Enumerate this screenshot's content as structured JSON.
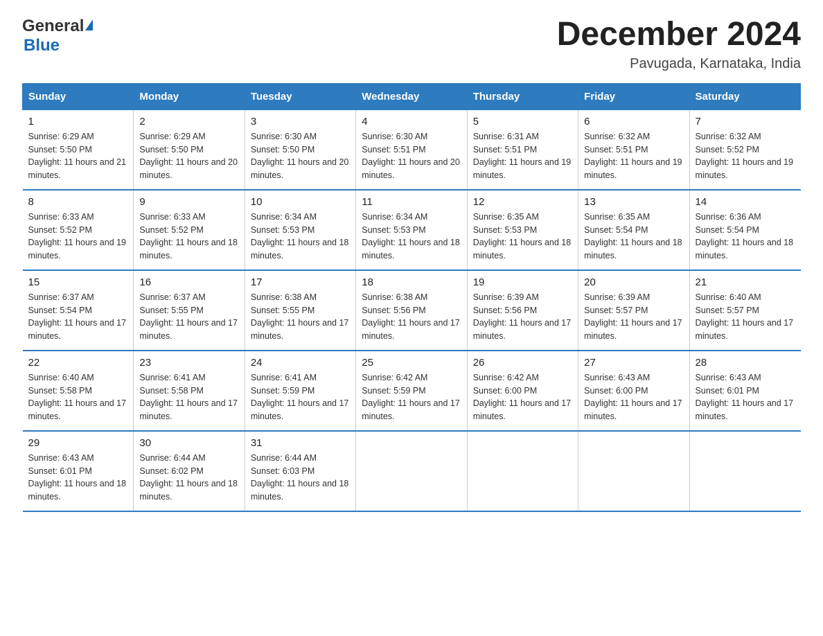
{
  "header": {
    "logo_general": "General",
    "logo_blue": "Blue",
    "month_title": "December 2024",
    "location": "Pavugada, Karnataka, India"
  },
  "days_of_week": [
    "Sunday",
    "Monday",
    "Tuesday",
    "Wednesday",
    "Thursday",
    "Friday",
    "Saturday"
  ],
  "weeks": [
    [
      {
        "day": "1",
        "sunrise": "6:29 AM",
        "sunset": "5:50 PM",
        "daylight": "11 hours and 21 minutes."
      },
      {
        "day": "2",
        "sunrise": "6:29 AM",
        "sunset": "5:50 PM",
        "daylight": "11 hours and 20 minutes."
      },
      {
        "day": "3",
        "sunrise": "6:30 AM",
        "sunset": "5:50 PM",
        "daylight": "11 hours and 20 minutes."
      },
      {
        "day": "4",
        "sunrise": "6:30 AM",
        "sunset": "5:51 PM",
        "daylight": "11 hours and 20 minutes."
      },
      {
        "day": "5",
        "sunrise": "6:31 AM",
        "sunset": "5:51 PM",
        "daylight": "11 hours and 19 minutes."
      },
      {
        "day": "6",
        "sunrise": "6:32 AM",
        "sunset": "5:51 PM",
        "daylight": "11 hours and 19 minutes."
      },
      {
        "day": "7",
        "sunrise": "6:32 AM",
        "sunset": "5:52 PM",
        "daylight": "11 hours and 19 minutes."
      }
    ],
    [
      {
        "day": "8",
        "sunrise": "6:33 AM",
        "sunset": "5:52 PM",
        "daylight": "11 hours and 19 minutes."
      },
      {
        "day": "9",
        "sunrise": "6:33 AM",
        "sunset": "5:52 PM",
        "daylight": "11 hours and 18 minutes."
      },
      {
        "day": "10",
        "sunrise": "6:34 AM",
        "sunset": "5:53 PM",
        "daylight": "11 hours and 18 minutes."
      },
      {
        "day": "11",
        "sunrise": "6:34 AM",
        "sunset": "5:53 PM",
        "daylight": "11 hours and 18 minutes."
      },
      {
        "day": "12",
        "sunrise": "6:35 AM",
        "sunset": "5:53 PM",
        "daylight": "11 hours and 18 minutes."
      },
      {
        "day": "13",
        "sunrise": "6:35 AM",
        "sunset": "5:54 PM",
        "daylight": "11 hours and 18 minutes."
      },
      {
        "day": "14",
        "sunrise": "6:36 AM",
        "sunset": "5:54 PM",
        "daylight": "11 hours and 18 minutes."
      }
    ],
    [
      {
        "day": "15",
        "sunrise": "6:37 AM",
        "sunset": "5:54 PM",
        "daylight": "11 hours and 17 minutes."
      },
      {
        "day": "16",
        "sunrise": "6:37 AM",
        "sunset": "5:55 PM",
        "daylight": "11 hours and 17 minutes."
      },
      {
        "day": "17",
        "sunrise": "6:38 AM",
        "sunset": "5:55 PM",
        "daylight": "11 hours and 17 minutes."
      },
      {
        "day": "18",
        "sunrise": "6:38 AM",
        "sunset": "5:56 PM",
        "daylight": "11 hours and 17 minutes."
      },
      {
        "day": "19",
        "sunrise": "6:39 AM",
        "sunset": "5:56 PM",
        "daylight": "11 hours and 17 minutes."
      },
      {
        "day": "20",
        "sunrise": "6:39 AM",
        "sunset": "5:57 PM",
        "daylight": "11 hours and 17 minutes."
      },
      {
        "day": "21",
        "sunrise": "6:40 AM",
        "sunset": "5:57 PM",
        "daylight": "11 hours and 17 minutes."
      }
    ],
    [
      {
        "day": "22",
        "sunrise": "6:40 AM",
        "sunset": "5:58 PM",
        "daylight": "11 hours and 17 minutes."
      },
      {
        "day": "23",
        "sunrise": "6:41 AM",
        "sunset": "5:58 PM",
        "daylight": "11 hours and 17 minutes."
      },
      {
        "day": "24",
        "sunrise": "6:41 AM",
        "sunset": "5:59 PM",
        "daylight": "11 hours and 17 minutes."
      },
      {
        "day": "25",
        "sunrise": "6:42 AM",
        "sunset": "5:59 PM",
        "daylight": "11 hours and 17 minutes."
      },
      {
        "day": "26",
        "sunrise": "6:42 AM",
        "sunset": "6:00 PM",
        "daylight": "11 hours and 17 minutes."
      },
      {
        "day": "27",
        "sunrise": "6:43 AM",
        "sunset": "6:00 PM",
        "daylight": "11 hours and 17 minutes."
      },
      {
        "day": "28",
        "sunrise": "6:43 AM",
        "sunset": "6:01 PM",
        "daylight": "11 hours and 17 minutes."
      }
    ],
    [
      {
        "day": "29",
        "sunrise": "6:43 AM",
        "sunset": "6:01 PM",
        "daylight": "11 hours and 18 minutes."
      },
      {
        "day": "30",
        "sunrise": "6:44 AM",
        "sunset": "6:02 PM",
        "daylight": "11 hours and 18 minutes."
      },
      {
        "day": "31",
        "sunrise": "6:44 AM",
        "sunset": "6:03 PM",
        "daylight": "11 hours and 18 minutes."
      },
      {
        "day": "",
        "sunrise": "",
        "sunset": "",
        "daylight": ""
      },
      {
        "day": "",
        "sunrise": "",
        "sunset": "",
        "daylight": ""
      },
      {
        "day": "",
        "sunrise": "",
        "sunset": "",
        "daylight": ""
      },
      {
        "day": "",
        "sunrise": "",
        "sunset": "",
        "daylight": ""
      }
    ]
  ],
  "labels": {
    "sunrise_prefix": "Sunrise: ",
    "sunset_prefix": "Sunset: ",
    "daylight_prefix": "Daylight: "
  }
}
